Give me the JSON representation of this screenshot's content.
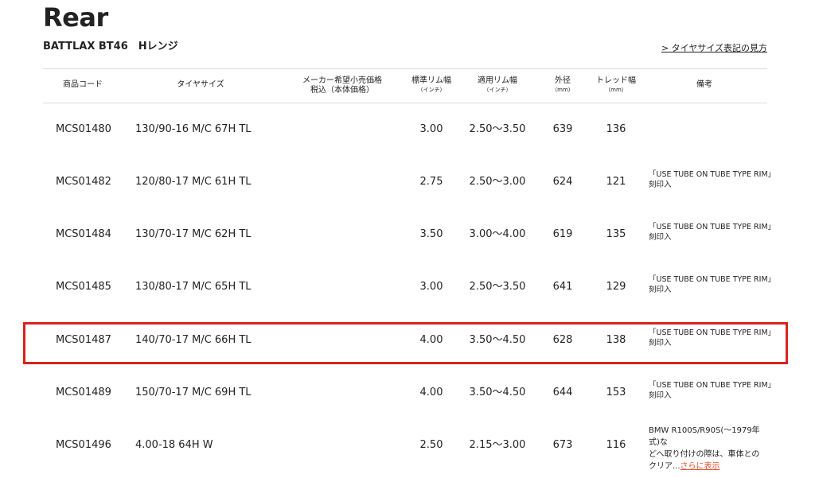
{
  "page": {
    "title": "Rear",
    "subtitle": "BATTLAX BT46　Hレンジ",
    "size_guide_link": "> タイヤサイズ表記の見方"
  },
  "table": {
    "headers": {
      "code": "商品コード",
      "size": "タイヤサイズ",
      "price_line1": "メーカー希望小売価格",
      "price_line2": "税込（本体価格）",
      "std_rim": "標準リム幅",
      "std_rim_unit": "（インチ）",
      "app_rim": "適用リム幅",
      "app_rim_unit": "（インチ）",
      "diameter": "外径",
      "diameter_unit": "（mm）",
      "tread": "トレッド幅",
      "tread_unit": "（mm）",
      "remarks": "備考"
    },
    "rows": [
      {
        "code": "MCS01480",
        "size": "130/90-16 M/C 67H TL",
        "std_rim": "3.00",
        "app_rim": "2.50〜3.50",
        "diameter": "639",
        "tread": "136",
        "note1": "",
        "note2": ""
      },
      {
        "code": "MCS01482",
        "size": "120/80-17 M/C 61H TL",
        "std_rim": "2.75",
        "app_rim": "2.50〜3.00",
        "diameter": "624",
        "tread": "121",
        "note1": "「USE TUBE ON TUBE TYPE RIM」",
        "note2": "刻印入"
      },
      {
        "code": "MCS01484",
        "size": "130/70-17 M/C 62H TL",
        "std_rim": "3.50",
        "app_rim": "3.00〜4.00",
        "diameter": "619",
        "tread": "135",
        "note1": "「USE TUBE ON TUBE TYPE RIM」",
        "note2": "刻印入"
      },
      {
        "code": "MCS01485",
        "size": "130/80-17 M/C 65H TL",
        "std_rim": "3.00",
        "app_rim": "2.50〜3.50",
        "diameter": "641",
        "tread": "129",
        "note1": "「USE TUBE ON TUBE TYPE RIM」",
        "note2": "刻印入"
      },
      {
        "code": "MCS01487",
        "size": "140/70-17 M/C 66H TL",
        "std_rim": "4.00",
        "app_rim": "3.50〜4.50",
        "diameter": "628",
        "tread": "138",
        "note1": "「USE TUBE ON TUBE TYPE RIM」",
        "note2": "刻印入"
      },
      {
        "code": "MCS01489",
        "size": "150/70-17 M/C 69H TL",
        "std_rim": "4.00",
        "app_rim": "3.50〜4.50",
        "diameter": "644",
        "tread": "153",
        "note1": "「USE TUBE ON TUBE TYPE RIM」",
        "note2": "刻印入"
      },
      {
        "code": "MCS01496",
        "size": "4.00-18 64H W",
        "std_rim": "2.50",
        "app_rim": "2.15〜3.00",
        "diameter": "673",
        "tread": "116",
        "note1": "BMW R100S/R90S(〜1979年式)な",
        "note2": "どへ取り付けの際は、車体との",
        "note3": "クリア...",
        "more": "さらに表示"
      }
    ]
  },
  "highlight_color": "#d9221c",
  "link_color": "#e8502f"
}
